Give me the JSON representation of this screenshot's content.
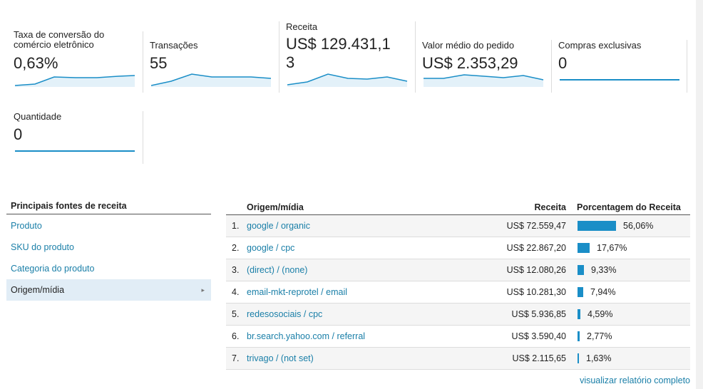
{
  "metrics": [
    {
      "label_line1": "Taxa de conversão do",
      "label_line2": "comércio eletrônico",
      "value": "0,63%"
    },
    {
      "label_line1": "Transações",
      "label_line2": "",
      "value": "55"
    },
    {
      "label_line1": "Receita",
      "label_line2": "",
      "value_line1": "US$ 129.431,1",
      "value_line2": "3"
    },
    {
      "label_line1": "Valor médio do pedido",
      "label_line2": "",
      "value": "US$ 2.353,29"
    },
    {
      "label_line1": "Compras exclusivas",
      "label_line2": "",
      "value": "0"
    },
    {
      "label_line1": "Quantidade",
      "label_line2": "",
      "value": "0"
    }
  ],
  "left_panel": {
    "header": "Principais fontes de receita",
    "items": [
      "Produto",
      "SKU do produto",
      "Categoria do produto",
      "Origem/mídia"
    ],
    "active_index": 3,
    "caret": "▸"
  },
  "table": {
    "headers": {
      "source": "Origem/mídia",
      "revenue": "Receita",
      "percent": "Porcentagem do Receita"
    },
    "rows": [
      {
        "index": "1.",
        "source": "google / organic",
        "revenue": "US$ 72.559,47",
        "percent": "56,06%",
        "share": 0.5606
      },
      {
        "index": "2.",
        "source": "google / cpc",
        "revenue": "US$ 22.867,20",
        "percent": "17,67%",
        "share": 0.1767
      },
      {
        "index": "3.",
        "source": "(direct) / (none)",
        "revenue": "US$ 12.080,26",
        "percent": "9,33%",
        "share": 0.0933
      },
      {
        "index": "4.",
        "source": "email-mkt-reprotel / email",
        "revenue": "US$ 10.281,30",
        "percent": "7,94%",
        "share": 0.0794
      },
      {
        "index": "5.",
        "source": "redesosociais / cpc",
        "revenue": "US$ 5.936,85",
        "percent": "4,59%",
        "share": 0.0459
      },
      {
        "index": "6.",
        "source": "br.search.yahoo.com / referral",
        "revenue": "US$ 3.590,40",
        "percent": "2,77%",
        "share": 0.0277
      },
      {
        "index": "7.",
        "source": "trivago / (not set)",
        "revenue": "US$ 2.115,65",
        "percent": "1,63%",
        "share": 0.0163
      }
    ]
  },
  "full_report_link": "visualizar relatório completo",
  "colors": {
    "accent": "#1a8ec7",
    "link": "#1a7fa8",
    "spark_fill": "#e3f1f9"
  }
}
